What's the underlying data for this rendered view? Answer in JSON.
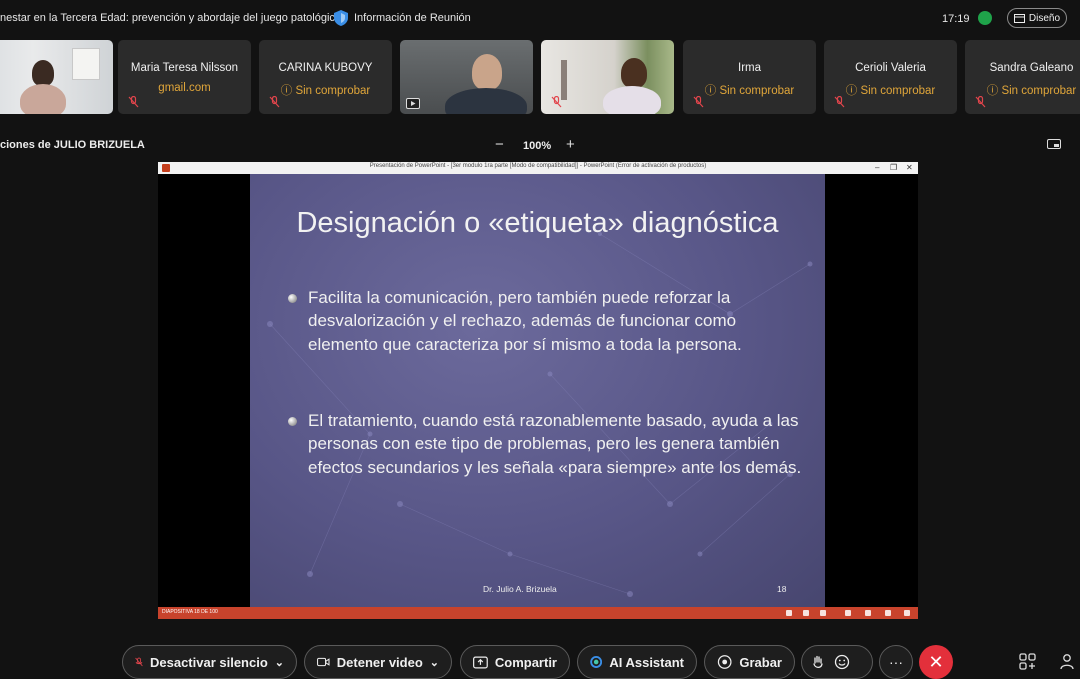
{
  "header": {
    "meeting_title": "nestar en la Tercera Edad: prevención y abordaje del juego patológico\"",
    "info_label": "Información de Reunión",
    "clock": "17:19",
    "layout_label": "Diseño"
  },
  "participants": [
    {
      "name": "Maria Teresa Nilsson",
      "status": "gmail.com"
    },
    {
      "name": "CARINA KUBOVY",
      "status": "Sin comprobar"
    },
    {
      "name": "Irma",
      "status": "Sin comprobar"
    },
    {
      "name": "Cerioli Valeria",
      "status": "Sin comprobar"
    },
    {
      "name": "Sandra Galeano",
      "status": "Sin comprobar"
    }
  ],
  "share": {
    "label": "ciones de JULIO BRIZUELA",
    "zoom": "100%",
    "zoom_minus": "−",
    "zoom_plus": "+"
  },
  "ppt": {
    "window_title": "Presentación de PowerPoint - [3er modulo 1ra parte [Modo de compatibilidad]] - PowerPoint (Error de activación de productos)",
    "status_text": "DIAPOSITIVA 18 DE 100"
  },
  "slide": {
    "title": "Designación o «etiqueta» diagnóstica",
    "bullets": [
      "Facilita la comunicación, pero también puede reforzar la desvalorización y el rechazo, además de funcionar como elemento que caracteriza por sí mismo a toda la persona.",
      "El tratamiento, cuando está razonablemente basado, ayuda a las personas con este tipo de problemas, pero les genera también efectos secundarios y les señala «para siempre» ante los demás."
    ],
    "footer": "Dr. Julio A. Brizuela",
    "number": "18"
  },
  "toolbar": {
    "unmute": "Desactivar silencio",
    "stop_video": "Detener video",
    "share": "Compartir",
    "ai_assistant": "AI Assistant",
    "record": "Grabar",
    "more": "···",
    "end": "✕"
  },
  "colors": {
    "accent_red": "#e3303b",
    "status_orange": "#e0a63a",
    "ppt_red": "#c8432c"
  }
}
